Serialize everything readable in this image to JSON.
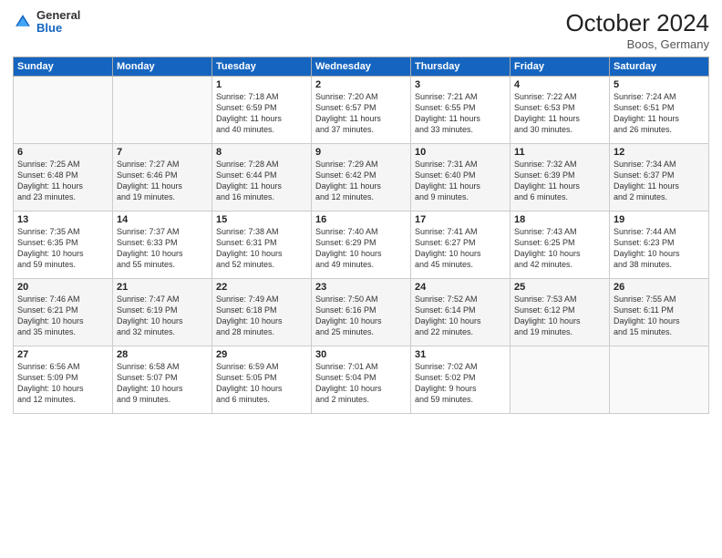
{
  "header": {
    "logo_general": "General",
    "logo_blue": "Blue",
    "month_title": "October 2024",
    "location": "Boos, Germany"
  },
  "weekdays": [
    "Sunday",
    "Monday",
    "Tuesday",
    "Wednesday",
    "Thursday",
    "Friday",
    "Saturday"
  ],
  "weeks": [
    [
      {
        "day": "",
        "content": ""
      },
      {
        "day": "",
        "content": ""
      },
      {
        "day": "1",
        "content": "Sunrise: 7:18 AM\nSunset: 6:59 PM\nDaylight: 11 hours\nand 40 minutes."
      },
      {
        "day": "2",
        "content": "Sunrise: 7:20 AM\nSunset: 6:57 PM\nDaylight: 11 hours\nand 37 minutes."
      },
      {
        "day": "3",
        "content": "Sunrise: 7:21 AM\nSunset: 6:55 PM\nDaylight: 11 hours\nand 33 minutes."
      },
      {
        "day": "4",
        "content": "Sunrise: 7:22 AM\nSunset: 6:53 PM\nDaylight: 11 hours\nand 30 minutes."
      },
      {
        "day": "5",
        "content": "Sunrise: 7:24 AM\nSunset: 6:51 PM\nDaylight: 11 hours\nand 26 minutes."
      }
    ],
    [
      {
        "day": "6",
        "content": "Sunrise: 7:25 AM\nSunset: 6:48 PM\nDaylight: 11 hours\nand 23 minutes."
      },
      {
        "day": "7",
        "content": "Sunrise: 7:27 AM\nSunset: 6:46 PM\nDaylight: 11 hours\nand 19 minutes."
      },
      {
        "day": "8",
        "content": "Sunrise: 7:28 AM\nSunset: 6:44 PM\nDaylight: 11 hours\nand 16 minutes."
      },
      {
        "day": "9",
        "content": "Sunrise: 7:29 AM\nSunset: 6:42 PM\nDaylight: 11 hours\nand 12 minutes."
      },
      {
        "day": "10",
        "content": "Sunrise: 7:31 AM\nSunset: 6:40 PM\nDaylight: 11 hours\nand 9 minutes."
      },
      {
        "day": "11",
        "content": "Sunrise: 7:32 AM\nSunset: 6:39 PM\nDaylight: 11 hours\nand 6 minutes."
      },
      {
        "day": "12",
        "content": "Sunrise: 7:34 AM\nSunset: 6:37 PM\nDaylight: 11 hours\nand 2 minutes."
      }
    ],
    [
      {
        "day": "13",
        "content": "Sunrise: 7:35 AM\nSunset: 6:35 PM\nDaylight: 10 hours\nand 59 minutes."
      },
      {
        "day": "14",
        "content": "Sunrise: 7:37 AM\nSunset: 6:33 PM\nDaylight: 10 hours\nand 55 minutes."
      },
      {
        "day": "15",
        "content": "Sunrise: 7:38 AM\nSunset: 6:31 PM\nDaylight: 10 hours\nand 52 minutes."
      },
      {
        "day": "16",
        "content": "Sunrise: 7:40 AM\nSunset: 6:29 PM\nDaylight: 10 hours\nand 49 minutes."
      },
      {
        "day": "17",
        "content": "Sunrise: 7:41 AM\nSunset: 6:27 PM\nDaylight: 10 hours\nand 45 minutes."
      },
      {
        "day": "18",
        "content": "Sunrise: 7:43 AM\nSunset: 6:25 PM\nDaylight: 10 hours\nand 42 minutes."
      },
      {
        "day": "19",
        "content": "Sunrise: 7:44 AM\nSunset: 6:23 PM\nDaylight: 10 hours\nand 38 minutes."
      }
    ],
    [
      {
        "day": "20",
        "content": "Sunrise: 7:46 AM\nSunset: 6:21 PM\nDaylight: 10 hours\nand 35 minutes."
      },
      {
        "day": "21",
        "content": "Sunrise: 7:47 AM\nSunset: 6:19 PM\nDaylight: 10 hours\nand 32 minutes."
      },
      {
        "day": "22",
        "content": "Sunrise: 7:49 AM\nSunset: 6:18 PM\nDaylight: 10 hours\nand 28 minutes."
      },
      {
        "day": "23",
        "content": "Sunrise: 7:50 AM\nSunset: 6:16 PM\nDaylight: 10 hours\nand 25 minutes."
      },
      {
        "day": "24",
        "content": "Sunrise: 7:52 AM\nSunset: 6:14 PM\nDaylight: 10 hours\nand 22 minutes."
      },
      {
        "day": "25",
        "content": "Sunrise: 7:53 AM\nSunset: 6:12 PM\nDaylight: 10 hours\nand 19 minutes."
      },
      {
        "day": "26",
        "content": "Sunrise: 7:55 AM\nSunset: 6:11 PM\nDaylight: 10 hours\nand 15 minutes."
      }
    ],
    [
      {
        "day": "27",
        "content": "Sunrise: 6:56 AM\nSunset: 5:09 PM\nDaylight: 10 hours\nand 12 minutes."
      },
      {
        "day": "28",
        "content": "Sunrise: 6:58 AM\nSunset: 5:07 PM\nDaylight: 10 hours\nand 9 minutes."
      },
      {
        "day": "29",
        "content": "Sunrise: 6:59 AM\nSunset: 5:05 PM\nDaylight: 10 hours\nand 6 minutes."
      },
      {
        "day": "30",
        "content": "Sunrise: 7:01 AM\nSunset: 5:04 PM\nDaylight: 10 hours\nand 2 minutes."
      },
      {
        "day": "31",
        "content": "Sunrise: 7:02 AM\nSunset: 5:02 PM\nDaylight: 9 hours\nand 59 minutes."
      },
      {
        "day": "",
        "content": ""
      },
      {
        "day": "",
        "content": ""
      }
    ]
  ]
}
